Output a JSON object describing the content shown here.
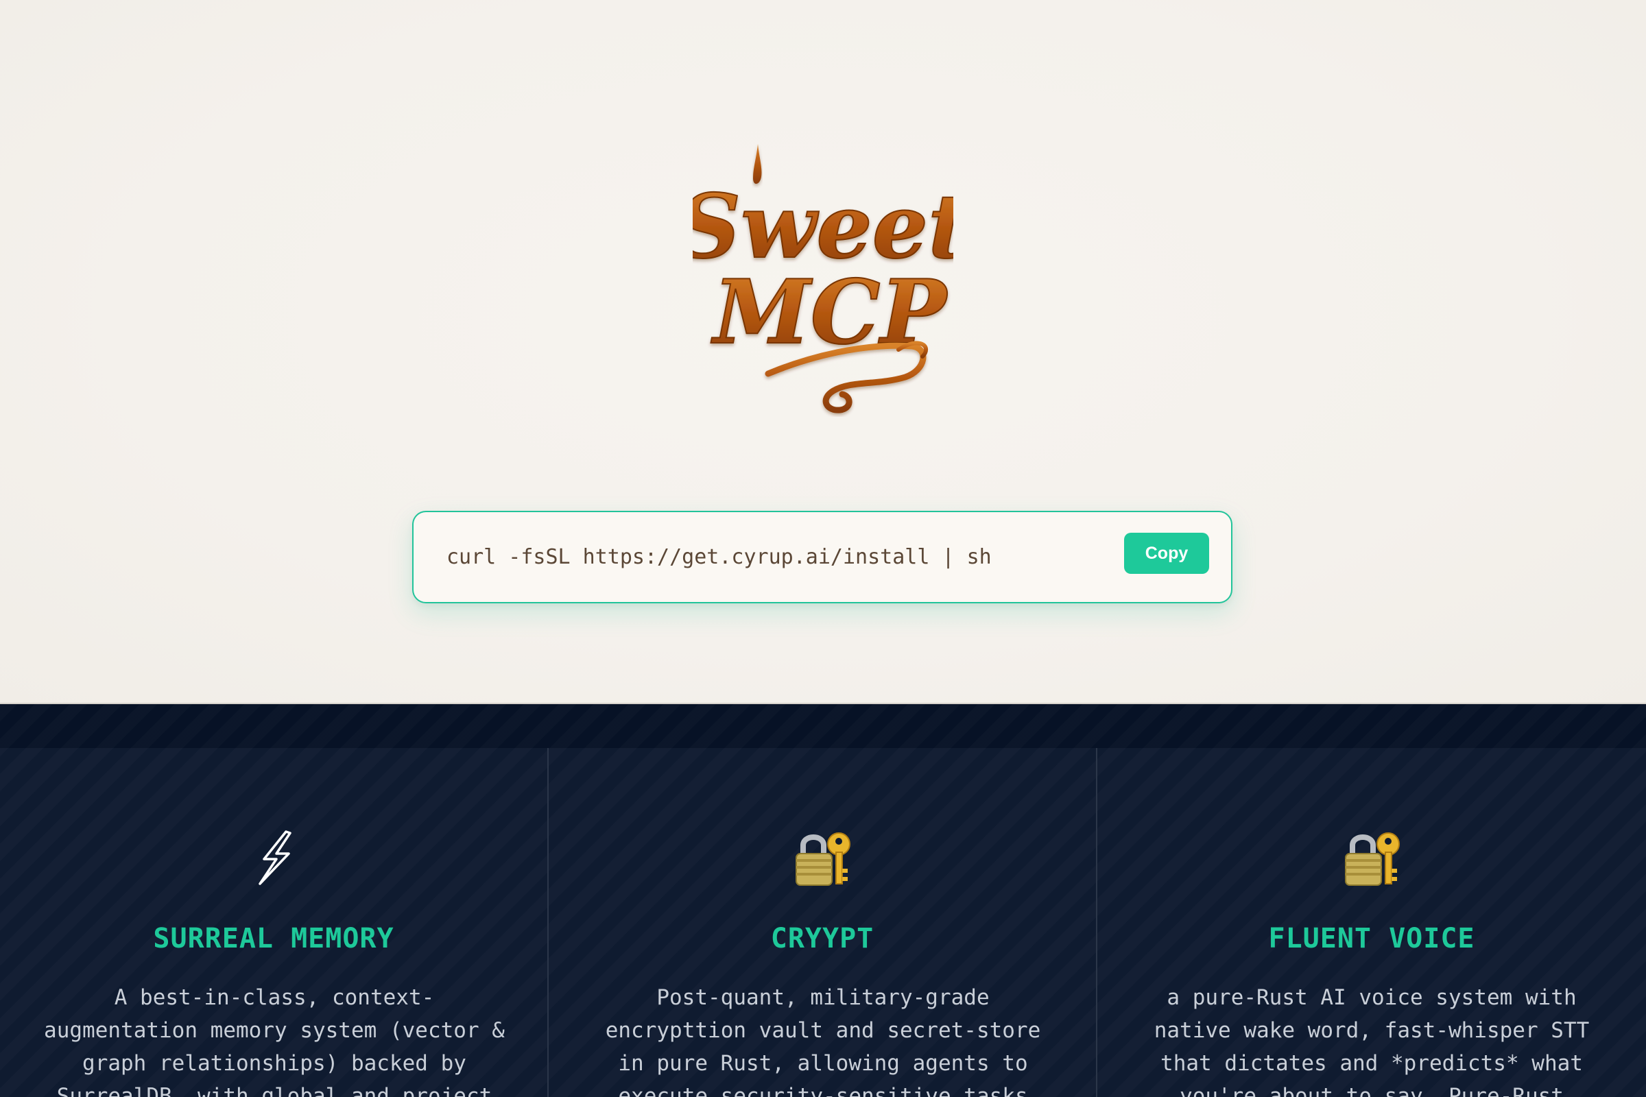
{
  "brand": {
    "logo_line1": "Sweet",
    "logo_line2": "MCP"
  },
  "install": {
    "command": "curl -fsSL https://get.cyrup.ai/install | sh",
    "copy_label": "Copy"
  },
  "colors": {
    "accent": "#1ec99a",
    "hero_bg": "#f5f2ed",
    "features_bg": "#0f1b30",
    "logo_caramel": "#b85a12",
    "feature_text": "#c9cfd8"
  },
  "features": [
    {
      "icon": "lightning-icon",
      "title": "SURREAL MEMORY",
      "description": "A best-in-class, context-augmentation memory system (vector & graph relationships) backed by SurrealDB, with global and project"
    },
    {
      "icon": "lock-with-key-icon",
      "title": "CRYYPT",
      "description": "Post-quant, military-grade encrypttion vault and secret-store in pure Rust, allowing agents to execute security-sensitive tasks"
    },
    {
      "icon": "lock-with-key-icon",
      "title": "FLUENT VOICE",
      "description": "a pure-Rust AI voice system with native wake word, fast-whisper STT that dictates and *predicts* what you're about to say. Pure-Rust"
    }
  ]
}
